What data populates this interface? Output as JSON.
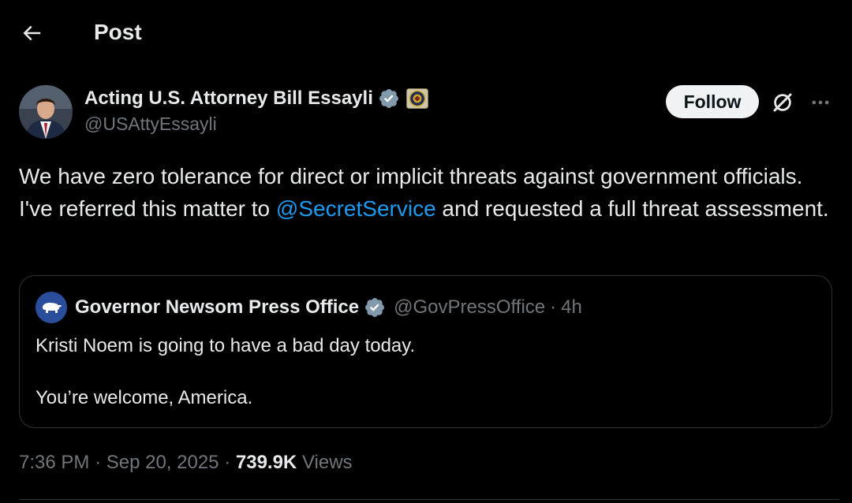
{
  "header": {
    "title": "Post"
  },
  "author": {
    "display_name": "Acting U.S. Attorney Bill Essayli",
    "handle": "@USAttyEssayli",
    "follow_label": "Follow"
  },
  "post": {
    "text_before": "We have zero tolerance for direct or implicit threats against government officials. I've referred this matter to ",
    "mention": "@SecretService",
    "text_after": " and requested a full threat assessment."
  },
  "quote": {
    "display_name": "Governor Newsom Press Office",
    "handle": "@GovPressOffice",
    "separator": "·",
    "time": "4h",
    "line1": "Kristi Noem is going to have a bad day today.",
    "line2": "You’re welcome, America."
  },
  "meta": {
    "time": "7:36 PM",
    "separator1": "·",
    "date": "Sep 20, 2025",
    "separator2": "·",
    "views_count": "739.9K",
    "views_label": "Views"
  },
  "colors": {
    "background": "#000000",
    "text": "#e7e9ea",
    "secondary": "#71767b",
    "link": "#1d9bf0",
    "border": "#2f3336",
    "verified_grey": "#829aab"
  },
  "icons": {
    "back": "arrow-left-icon",
    "verified": "verified-badge-icon",
    "affiliate": "doj-seal-icon",
    "grok": "grok-icon",
    "more": "more-horizontal-icon",
    "quote_avatar": "bear-icon"
  }
}
